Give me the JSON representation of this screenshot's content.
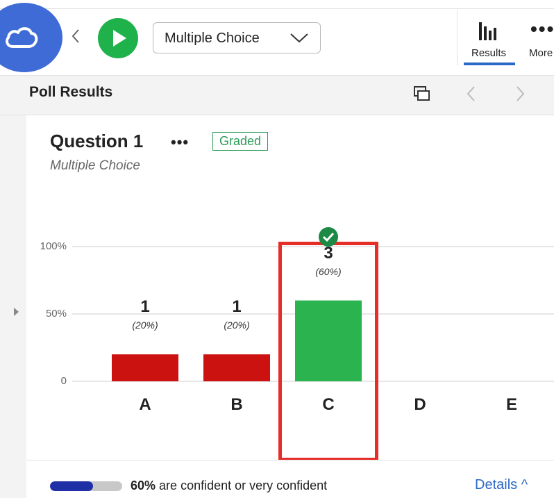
{
  "toolbar": {
    "logo_icon": "cloud-icon",
    "back_icon": "chevron-left-icon",
    "play_icon": "play-icon",
    "question_type": "Multiple Choice",
    "results_label": "Results",
    "more_label": "More",
    "colors": {
      "play": "#1fb24b",
      "logo": "#3f6bd6",
      "accent": "#2a68c8"
    }
  },
  "results_header": {
    "title": "Poll Results",
    "popout_icon": "popout-icon",
    "prev_icon": "chevron-left-icon",
    "next_icon": "chevron-right-icon"
  },
  "question": {
    "title": "Question 1",
    "more": "•••",
    "badge": "Graded",
    "subtitle": "Multiple Choice"
  },
  "chart_data": {
    "type": "bar",
    "categories": [
      "A",
      "B",
      "C",
      "D",
      "E"
    ],
    "values": [
      20,
      20,
      60,
      0,
      0
    ],
    "counts": [
      "1",
      "1",
      "3",
      "",
      ""
    ],
    "percent_labels": [
      "(20%)",
      "(20%)",
      "(60%)",
      "",
      ""
    ],
    "correct": [
      false,
      false,
      true,
      false,
      false
    ],
    "yticks": [
      "100%",
      "50%",
      "0"
    ],
    "ylim": [
      0,
      100
    ],
    "colors": {
      "incorrect": "#cc1111",
      "correct": "#2ab34f",
      "highlight": "#e52e28"
    }
  },
  "footer": {
    "confidence_fraction": 0.6,
    "confidence_value": "60%",
    "confidence_text": "are confident or very confident",
    "details_label": "Details ^"
  }
}
